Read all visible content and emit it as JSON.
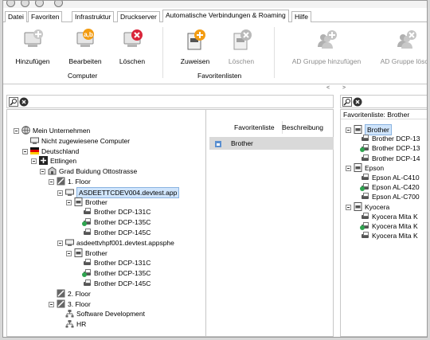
{
  "tabs": [
    {
      "label": "Datei",
      "active": false
    },
    {
      "label": "Favoriten",
      "active": false
    },
    {
      "label": "Infrastruktur",
      "active": false
    },
    {
      "label": "Druckserver",
      "active": false
    },
    {
      "label": "Automatische Verbindungen & Roaming",
      "active": true
    },
    {
      "label": "Hilfe",
      "active": false
    }
  ],
  "ribbon": {
    "computer_group": {
      "label": "Computer",
      "buttons": [
        {
          "label": "Hinzufügen",
          "icon": "add-computer-icon",
          "enabled": true
        },
        {
          "label": "Bearbeiten",
          "icon": "edit-computer-icon",
          "enabled": true
        },
        {
          "label": "Löschen",
          "icon": "delete-computer-icon",
          "enabled": true
        }
      ]
    },
    "favlist_group": {
      "label": "Favoritenlisten",
      "buttons": [
        {
          "label": "Zuweisen",
          "icon": "assign-list-icon",
          "enabled": true
        },
        {
          "label": "Löschen",
          "icon": "delete-list-icon",
          "enabled": false
        }
      ]
    },
    "ad_group": {
      "buttons": [
        {
          "label": "AD Gruppe hinzufügen",
          "icon": "add-ad-group-icon",
          "enabled": false
        },
        {
          "label": "AD Gruppe lösch",
          "icon": "delete-ad-group-icon",
          "enabled": false
        }
      ]
    }
  },
  "left_pane": {
    "collapse_arrow": "<",
    "tree": [
      {
        "label": "Mein Unternehmen",
        "icon": "globe-icon"
      },
      {
        "label": "Nicht zugewiesene Computer",
        "icon": "computer-icon"
      },
      {
        "label": "Deutschland",
        "icon": "flag-de-icon"
      },
      {
        "label": "Ettlingen",
        "icon": "city-icon"
      },
      {
        "label": "Grad Buidung Ottostrasse",
        "icon": "building-icon"
      },
      {
        "label": "1. Floor",
        "icon": "floor-icon"
      },
      {
        "label": "ASDEETTCDEV004.devtest.app",
        "icon": "computer-icon",
        "selected": true
      },
      {
        "label": "Brother",
        "icon": "favorite-list-icon"
      },
      {
        "label": "Brother DCP-131C",
        "icon": "printer-icon",
        "default": false
      },
      {
        "label": "Brother DCP-135C",
        "icon": "printer-icon",
        "default": true
      },
      {
        "label": "Brother DCP-145C",
        "icon": "printer-icon",
        "default": false
      },
      {
        "label": "asdeettvhpf001.devtest.appsphe",
        "icon": "computer-icon"
      },
      {
        "label": "Brother",
        "icon": "favorite-list-icon"
      },
      {
        "label": "Brother DCP-131C",
        "icon": "printer-icon",
        "default": false
      },
      {
        "label": "Brother DCP-135C",
        "icon": "printer-icon",
        "default": true
      },
      {
        "label": "Brother DCP-145C",
        "icon": "printer-icon",
        "default": false
      },
      {
        "label": "2. Floor",
        "icon": "floor-icon"
      },
      {
        "label": "3. Floor",
        "icon": "floor-icon"
      },
      {
        "label": "Software Development",
        "icon": "network-icon"
      },
      {
        "label": "HR",
        "icon": "network-icon"
      }
    ],
    "table": {
      "columns": [
        "Favoritenliste",
        "Beschreibung"
      ],
      "rows": [
        {
          "name": "Brother",
          "description": ""
        }
      ]
    }
  },
  "right_pane": {
    "collapse_arrow": ">",
    "header": "Favoritenliste: Brother",
    "tree": [
      {
        "label": "Brother",
        "icon": "favorite-list-icon",
        "selected": true
      },
      {
        "label": "Brother DCP-13",
        "icon": "printer-icon",
        "default": false
      },
      {
        "label": "Brother DCP-13",
        "icon": "printer-icon",
        "default": true
      },
      {
        "label": "Brother DCP-14",
        "icon": "printer-icon",
        "default": false
      },
      {
        "label": "Epson",
        "icon": "favorite-list-icon"
      },
      {
        "label": "Epson AL-C410",
        "icon": "printer-icon",
        "default": false
      },
      {
        "label": "Epson AL-C420",
        "icon": "printer-icon",
        "default": true
      },
      {
        "label": "Epson AL-C700",
        "icon": "printer-icon",
        "default": false
      },
      {
        "label": "Kyocera",
        "icon": "favorite-list-icon"
      },
      {
        "label": "Kyocera Mita K",
        "icon": "printer-icon",
        "default": false
      },
      {
        "label": "Kyocera Mita K",
        "icon": "printer-icon",
        "default": true
      },
      {
        "label": "Kyocera Mita K",
        "icon": "printer-icon",
        "default": false
      }
    ]
  },
  "colors": {
    "selection": "#cfe4fb",
    "red_icon": "#d9253a",
    "orange_icon": "#f39c12",
    "check_green": "#2ea44f"
  }
}
